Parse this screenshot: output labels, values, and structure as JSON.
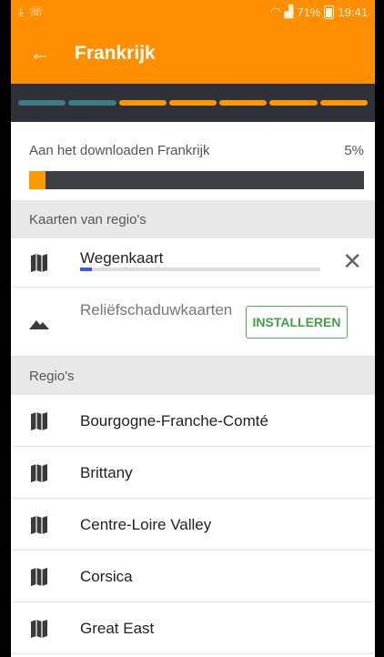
{
  "status_bar": {
    "left_icons": [
      "download-icon",
      "wifi-calling-icon"
    ],
    "battery_percent_text": "71%",
    "time": "19:41"
  },
  "app_bar": {
    "title": "Frankrijk"
  },
  "segment_progress": {
    "done_segments": 2,
    "total_segments": 7
  },
  "download": {
    "label": "Aan het downloaden Frankrijk",
    "percent_text": "5%",
    "progress": 0.05
  },
  "maps_section": {
    "header": "Kaarten van regio's",
    "items": [
      {
        "name": "Wegenkaart",
        "icon": "map-icon",
        "progress": 0.05,
        "action_icon": "close-icon"
      },
      {
        "name": "Reliëfschaduwkaarten",
        "icon": "mountain-icon",
        "action_label": "INSTALLEREN"
      }
    ]
  },
  "regions_section": {
    "header": "Regio's",
    "items": [
      {
        "name": "Bourgogne-Franche-Comté",
        "icon": "map-icon"
      },
      {
        "name": "Brittany",
        "icon": "map-icon"
      },
      {
        "name": "Centre-Loire Valley",
        "icon": "map-icon"
      },
      {
        "name": "Corsica",
        "icon": "map-icon"
      },
      {
        "name": "Great East",
        "icon": "map-icon"
      }
    ]
  },
  "colors": {
    "accent": "#ff8f00",
    "install_green": "#43a047",
    "strip_dark": "#2e3138"
  }
}
